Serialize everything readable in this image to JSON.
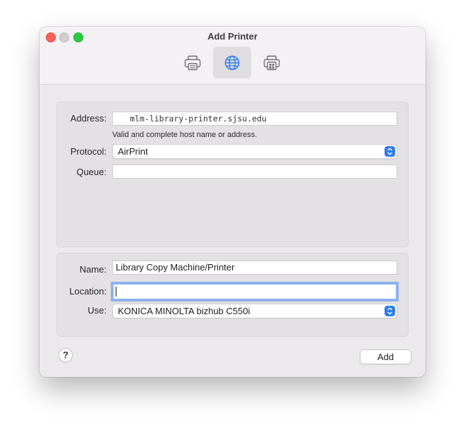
{
  "window": {
    "title": "Add Printer"
  },
  "toolbar": {
    "items": [
      {
        "icon": "printer-default-icon",
        "selected": false
      },
      {
        "icon": "globe-ip-icon",
        "selected": true
      },
      {
        "icon": "windows-printer-icon",
        "selected": false
      }
    ]
  },
  "connection": {
    "address_label": "Address:",
    "address_value": "mlm-library-printer.sjsu.edu",
    "address_hint": "Valid and complete host name or address.",
    "protocol_label": "Protocol:",
    "protocol_value": "AirPrint",
    "queue_label": "Queue:",
    "queue_value": ""
  },
  "details": {
    "name_label": "Name:",
    "name_value": "Library Copy Machine/Printer",
    "location_label": "Location:",
    "location_value": "",
    "use_label": "Use:",
    "use_value": "KONICA MINOLTA bizhub C550i"
  },
  "footer": {
    "help_label": "?",
    "add_label": "Add"
  },
  "colors": {
    "accent": "#2f7cf6",
    "focus_ring": "#8ab1ef",
    "window_bg": "#ece9ec"
  }
}
